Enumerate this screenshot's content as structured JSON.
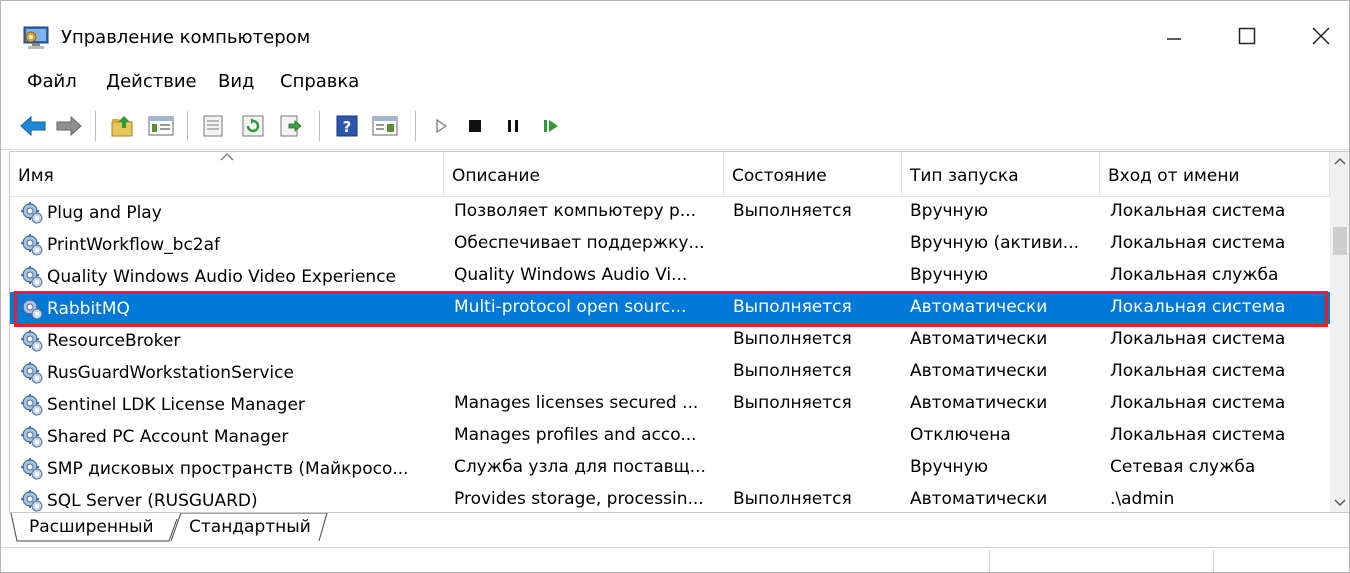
{
  "window": {
    "title": "Управление компьютером"
  },
  "menu": [
    "Файл",
    "Действие",
    "Вид",
    "Справка"
  ],
  "columns": [
    "Имя",
    "Описание",
    "Состояние",
    "Тип запуска",
    "Вход от имени"
  ],
  "rows": [
    {
      "name": "Plug and Play",
      "description": "Позволяет компьютеру р...",
      "state": "Выполняется",
      "startup": "Вручную",
      "logon": "Локальная система"
    },
    {
      "name": "PrintWorkflow_bc2af",
      "description": "Обеспечивает поддержку...",
      "state": "",
      "startup": "Вручную (активи...",
      "logon": "Локальная система"
    },
    {
      "name": "Quality Windows Audio Video Experience",
      "description": "Quality Windows Audio Vi...",
      "state": "",
      "startup": "Вручную",
      "logon": "Локальная служба"
    },
    {
      "name": "RabbitMQ",
      "description": "Multi-protocol open sourc...",
      "state": "Выполняется",
      "startup": "Автоматически",
      "logon": "Локальная система"
    },
    {
      "name": "ResourceBroker",
      "description": "",
      "state": "Выполняется",
      "startup": "Автоматически",
      "logon": "Локальная система"
    },
    {
      "name": "RusGuardWorkstationService",
      "description": "",
      "state": "Выполняется",
      "startup": "Автоматически",
      "logon": "Локальная система"
    },
    {
      "name": "Sentinel LDK License Manager",
      "description": "Manages licenses secured ...",
      "state": "Выполняется",
      "startup": "Автоматически",
      "logon": "Локальная система"
    },
    {
      "name": "Shared PC Account Manager",
      "description": "Manages profiles and acco...",
      "state": "",
      "startup": "Отключена",
      "logon": "Локальная система"
    },
    {
      "name": "SMP дисковых пространств (Майкросо...",
      "description": "Служба узла для поставщ...",
      "state": "",
      "startup": "Вручную",
      "logon": "Сетевая служба"
    },
    {
      "name": "SQL Server (RUSGUARD)",
      "description": "Provides storage, processin...",
      "state": "Выполняется",
      "startup": "Автоматически",
      "logon": ".\\admin"
    }
  ],
  "selected_row": "RabbitMQ",
  "tabs": [
    "Расширенный",
    "Стандартный"
  ],
  "active_tab": "Стандартный",
  "colors": {
    "selection": "#0078d7",
    "highlight_border": "#e3202b"
  },
  "icons": {
    "back": "arrow-left-icon",
    "forward": "arrow-right-icon",
    "up": "folder-up-icon",
    "console_tree": "console-tree-icon",
    "properties": "properties-icon",
    "refresh": "refresh-icon",
    "export": "export-list-icon",
    "help": "help-icon",
    "action_pane": "action-pane-icon",
    "start": "play-icon",
    "stop": "stop-icon",
    "pause": "pause-icon",
    "restart": "restart-icon",
    "service": "service-gear-icon"
  }
}
